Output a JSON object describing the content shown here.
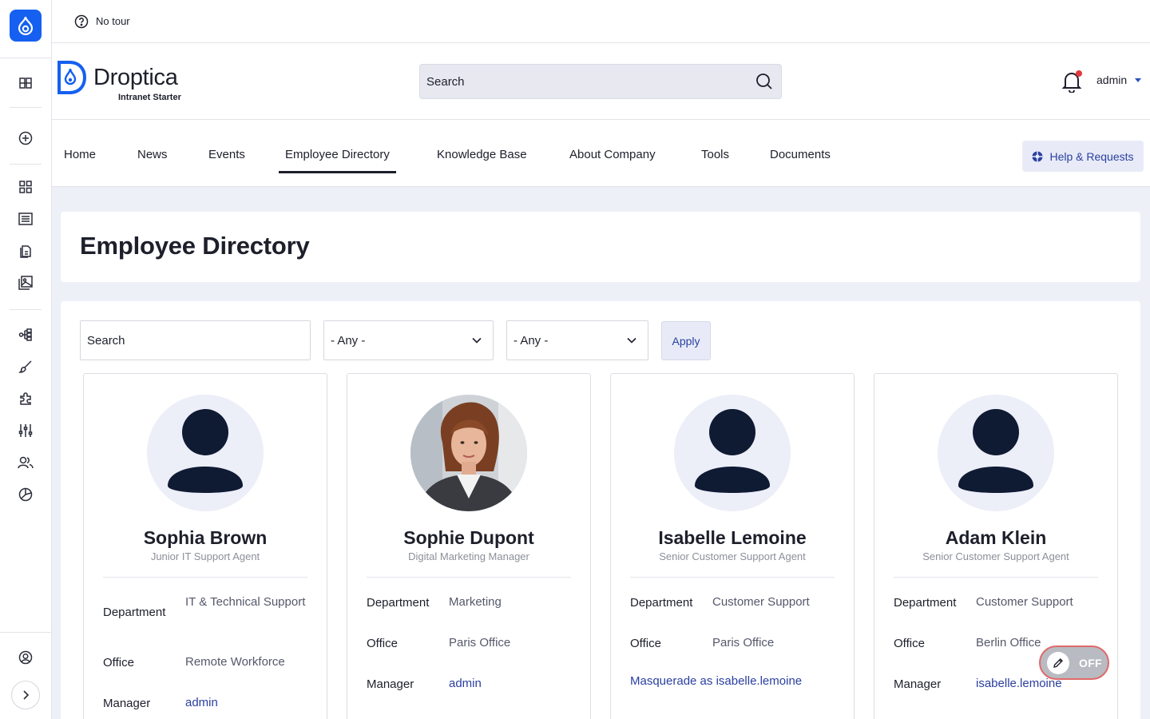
{
  "tour": {
    "label": "No tour"
  },
  "brand": {
    "name": "Droptica",
    "subtitle": "Intranet Starter"
  },
  "header": {
    "search_placeholder": "Search",
    "user": "admin"
  },
  "nav": {
    "items": [
      "Home",
      "News",
      "Events",
      "Employee Directory",
      "Knowledge Base",
      "About Company",
      "Tools",
      "Documents"
    ],
    "active": "Employee Directory",
    "help_label": "Help & Requests"
  },
  "page": {
    "title": "Employee Directory"
  },
  "filters": {
    "search_placeholder": "Search",
    "select1": "- Any -",
    "select2": "- Any -",
    "apply_label": "Apply"
  },
  "labels": {
    "department": "Department",
    "office": "Office",
    "manager": "Manager"
  },
  "employees": [
    {
      "name": "Sophia Brown",
      "role": "Junior IT Support Agent",
      "department": "IT & Technical Support",
      "office": "Remote Workforce",
      "manager": "admin"
    },
    {
      "name": "Sophie Dupont",
      "role": "Digital Marketing Manager",
      "department": "Marketing",
      "office": "Paris Office",
      "manager": "admin"
    },
    {
      "name": "Isabelle Lemoine",
      "role": "Senior Customer Support Agent",
      "department": "Customer Support",
      "office": "Paris Office",
      "masquerade": "Masquerade as isabelle.lemoine"
    },
    {
      "name": "Adam Klein",
      "role": "Senior Customer Support Agent",
      "department": "Customer Support",
      "office": "Berlin Office",
      "manager": "isabelle.lemoine"
    }
  ],
  "toggle": {
    "label": "OFF"
  },
  "colors": {
    "accent": "#2a3fa0",
    "brand_blue": "#1560f0",
    "avatar_bg": "#eceef8",
    "avatar_fg": "#0f1a33"
  }
}
